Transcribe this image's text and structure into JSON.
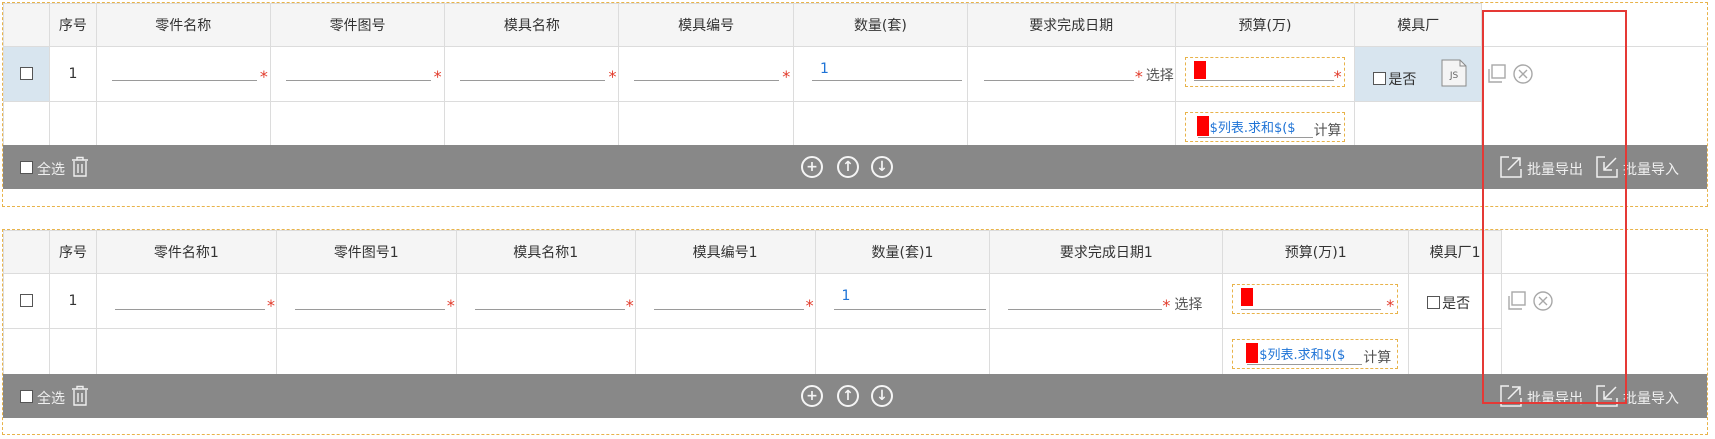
{
  "grid_a": {
    "headers": [
      "序号",
      "零件名称",
      "零件图号",
      "模具名称",
      "模具编号",
      "数量(套)",
      "要求完成日期",
      "预算(万)",
      "模具厂"
    ],
    "row_index": "1",
    "qty_value": "1",
    "date_select_label": "选择",
    "required_mark": "*",
    "factory_checkbox_label": "是否",
    "js_badge": "JS",
    "formula_text": "$列表.求和$($",
    "calc_label": "计算",
    "toolbar": {
      "select_all": "全选",
      "batch_export": "批量导出",
      "batch_import": "批量导入"
    }
  },
  "grid_b": {
    "headers": [
      "序号",
      "零件名称1",
      "零件图号1",
      "模具名称1",
      "模具编号1",
      "数量(套)1",
      "要求完成日期1",
      "预算(万)1",
      "模具厂1"
    ],
    "row_index": "1",
    "qty_value": "1",
    "date_select_label": "选择",
    "required_mark": "*",
    "factory_checkbox_label": "是否",
    "formula_text": "$列表.求和$($",
    "calc_label": "计算",
    "toolbar": {
      "select_all": "全选",
      "batch_export": "批量导出",
      "batch_import": "批量导入"
    }
  },
  "colors": {
    "highlight": "#e53935",
    "toolbar_bg": "#888888",
    "header_bg": "#f5f5f5",
    "link_blue": "#1e73d6",
    "required_red": "#e23a2a",
    "marker_red": "#ff0000"
  },
  "icons": [
    "trash-icon",
    "add-circle-icon",
    "arrow-up-circle-icon",
    "arrow-down-circle-icon",
    "export-icon",
    "import-icon",
    "copy-icon",
    "close-circle-icon",
    "js-file-icon"
  ]
}
